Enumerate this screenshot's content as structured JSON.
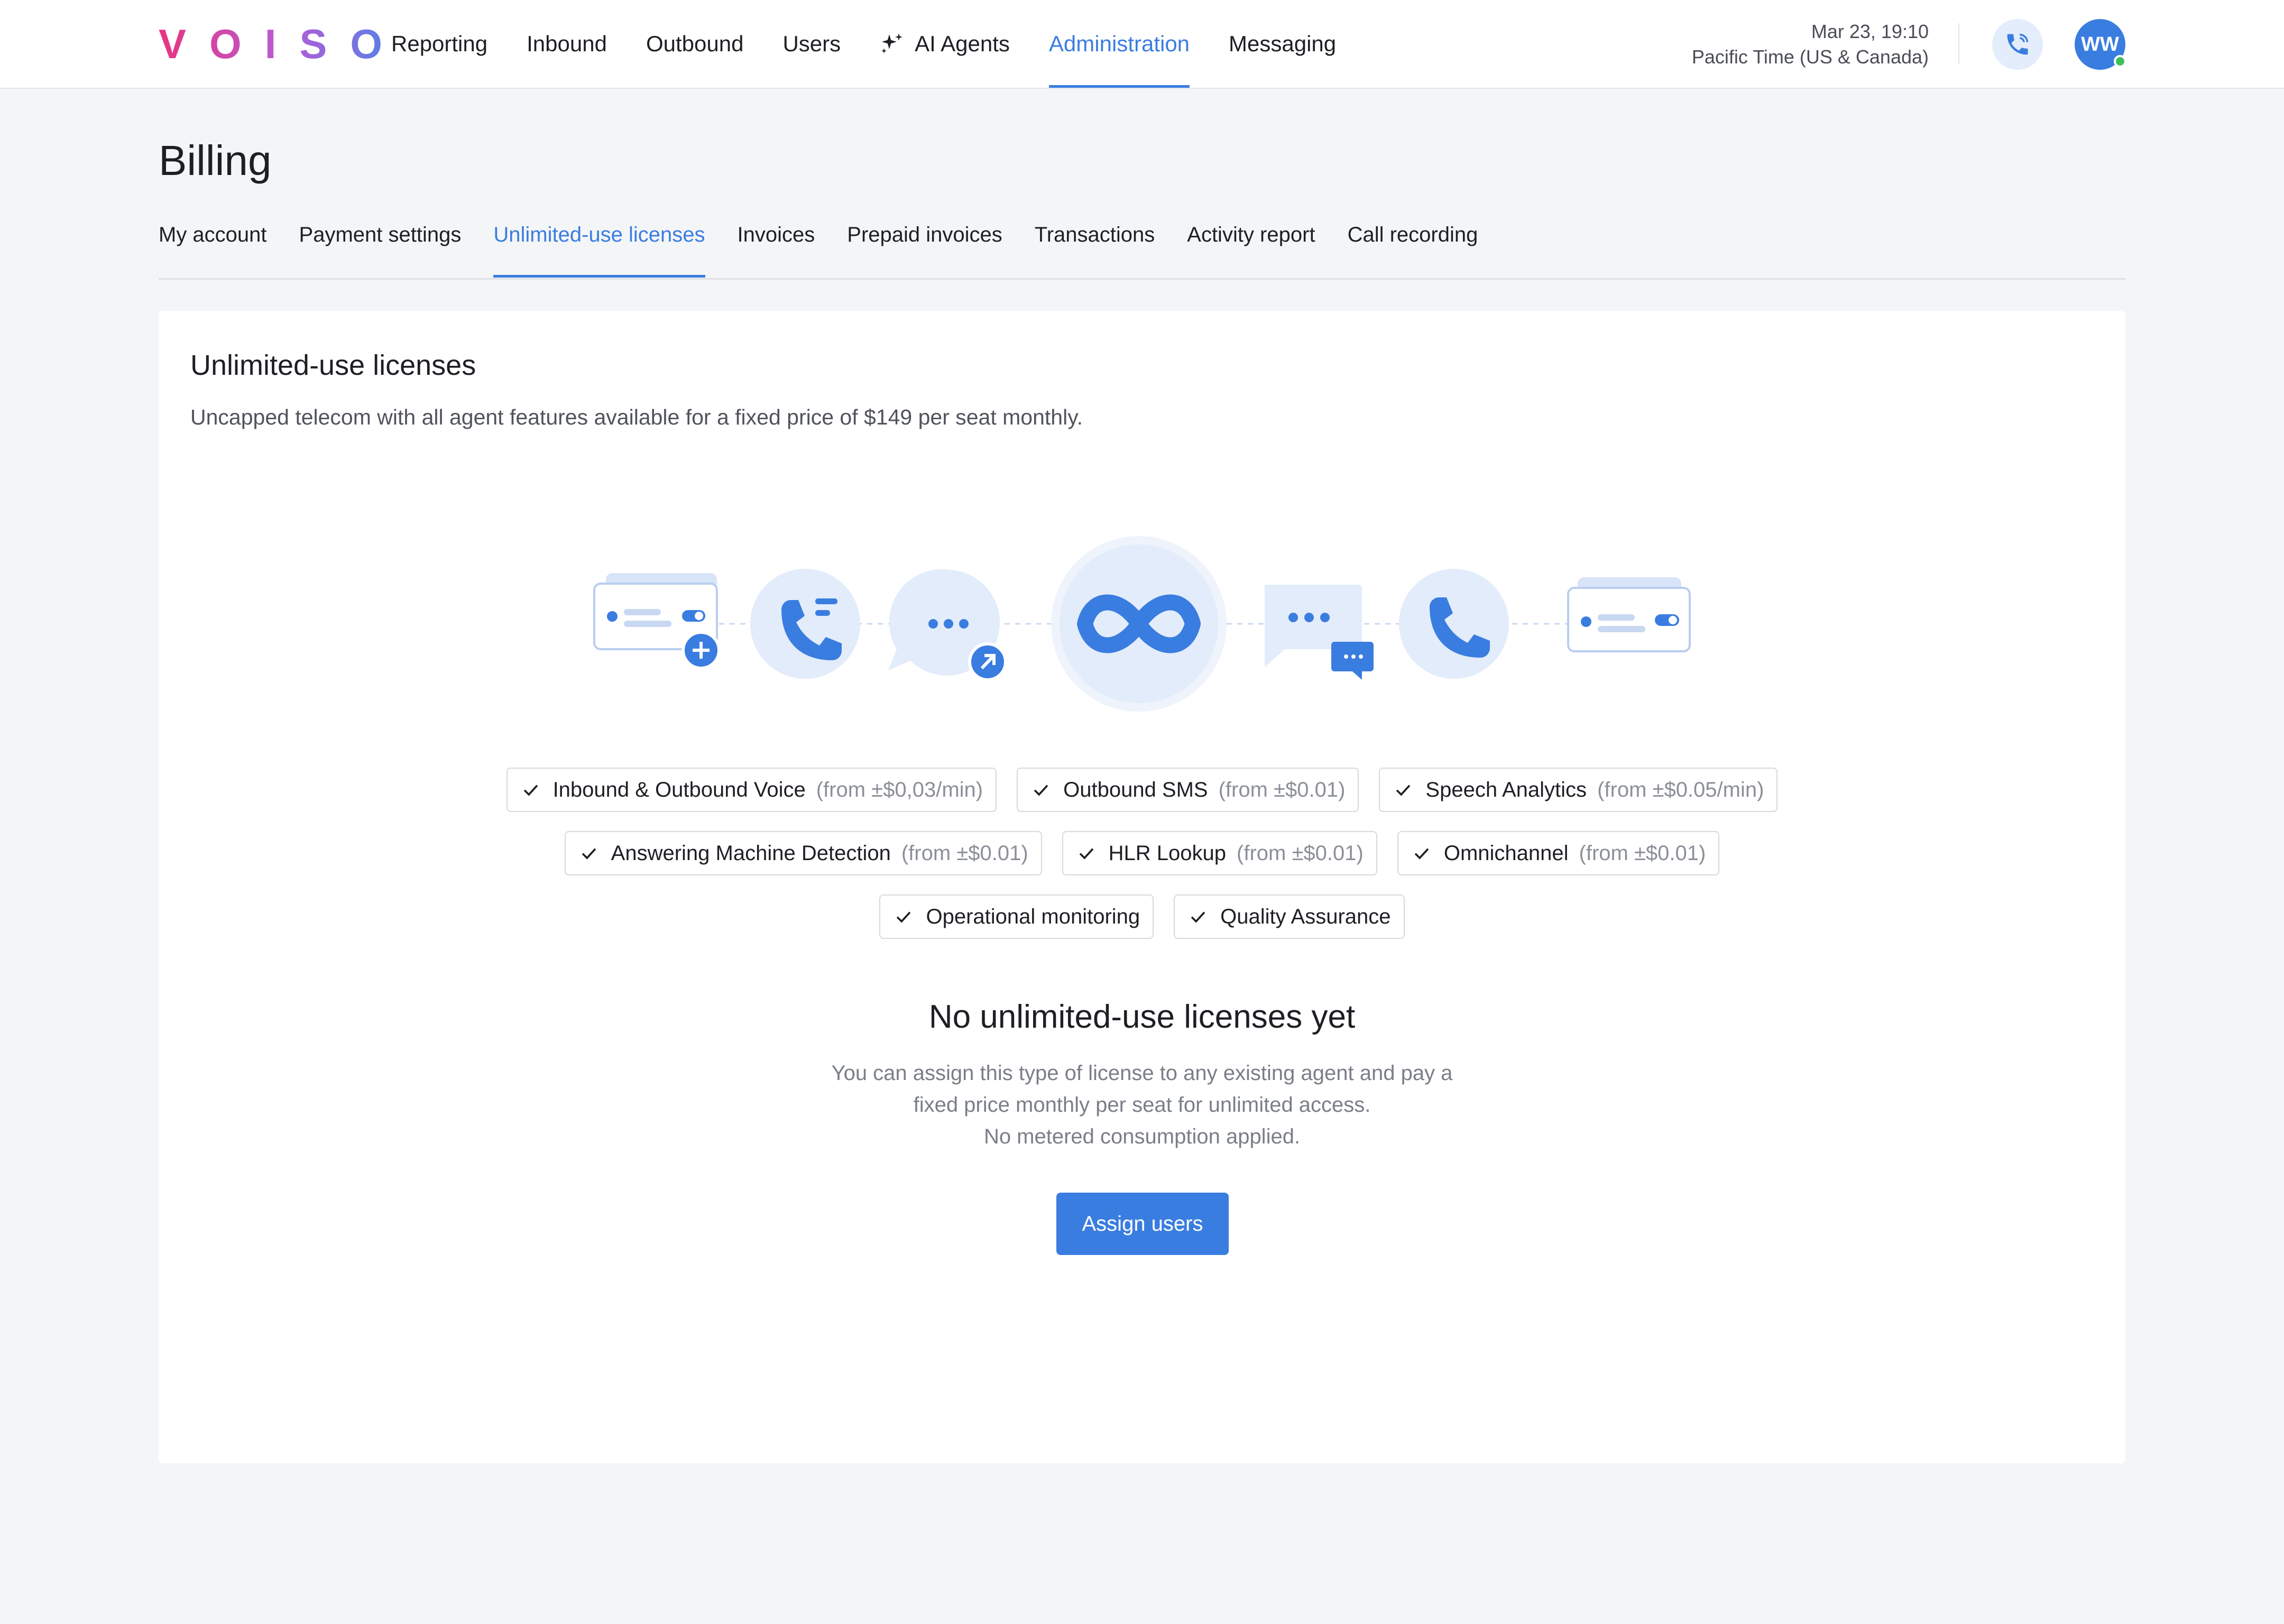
{
  "brand": {
    "logo_text": "VOISO"
  },
  "nav": {
    "items": [
      {
        "label": "Reporting"
      },
      {
        "label": "Inbound"
      },
      {
        "label": "Outbound"
      },
      {
        "label": "Users"
      },
      {
        "label": "AI Agents",
        "icon": "sparkle-icon"
      },
      {
        "label": "Administration",
        "active": true
      },
      {
        "label": "Messaging"
      }
    ]
  },
  "header": {
    "datetime": "Mar 23, 19:10",
    "timezone": "Pacific Time (US & Canada)",
    "call_icon": "phone-call-icon",
    "avatar_initials": "WW",
    "status_color": "#3fbf5a"
  },
  "page": {
    "title": "Billing"
  },
  "tabs": [
    {
      "label": "My account"
    },
    {
      "label": "Payment settings"
    },
    {
      "label": "Unlimited-use licenses",
      "active": true
    },
    {
      "label": "Invoices"
    },
    {
      "label": "Prepaid invoices"
    },
    {
      "label": "Transactions"
    },
    {
      "label": "Activity report"
    },
    {
      "label": "Call recording"
    }
  ],
  "card": {
    "title": "Unlimited-use licenses",
    "subtitle": "Uncapped telecom with all agent features available for a fixed price of $149 per seat monthly.",
    "illustration_icons": [
      "license-card-add-icon",
      "phone-list-icon",
      "chat-bubble-arrow-icon",
      "infinity-icon",
      "chat-messages-icon",
      "phone-icon",
      "license-card-icon"
    ]
  },
  "features": {
    "row1": [
      {
        "label": "Inbound & Outbound Voice",
        "price": "(from ±$0,03/min)"
      },
      {
        "label": "Outbound SMS",
        "price": "(from ±$0.01)"
      },
      {
        "label": "Speech Analytics",
        "price": "(from ±$0.05/min)"
      }
    ],
    "row2": [
      {
        "label": "Answering Machine Detection",
        "price": "(from ±$0.01)"
      },
      {
        "label": "HLR Lookup",
        "price": "(from ±$0.01)"
      },
      {
        "label": "Omnichannel",
        "price": "(from ±$0.01)"
      }
    ],
    "row3": [
      {
        "label": "Operational monitoring"
      },
      {
        "label": "Quality Assurance"
      }
    ]
  },
  "empty_state": {
    "title": "No unlimited-use licenses yet",
    "line1": "You can assign this type of license to any existing agent and pay a",
    "line2": "fixed price monthly per seat for unlimited access.",
    "line3": "No metered consumption applied.",
    "button_label": "Assign users"
  },
  "colors": {
    "accent": "#3a7de0",
    "page_bg": "#f4f5f7"
  }
}
